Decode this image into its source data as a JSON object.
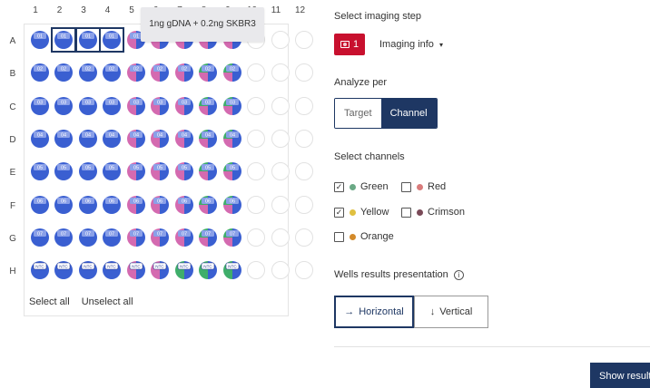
{
  "plate": {
    "columns": [
      "1",
      "2",
      "3",
      "4",
      "5",
      "6",
      "7",
      "8",
      "9",
      "10",
      "11",
      "12"
    ],
    "rows": [
      "A",
      "B",
      "C",
      "D",
      "E",
      "F",
      "G",
      "H"
    ],
    "filled_columns": 9,
    "selected_wells": [
      "A2",
      "A3",
      "A4"
    ],
    "well_labels": [
      "01",
      "02",
      "03",
      "04",
      "05",
      "06",
      "07",
      "NTC"
    ],
    "colors": {
      "blue": "#3a5fd1",
      "blue_dark": "#2a3c8f",
      "pink": "#d46ab0",
      "green": "#3fae6a",
      "cap": "#8aa0e8"
    },
    "footer": {
      "select_all": "Select all",
      "unselect_all": "Unselect all"
    }
  },
  "tooltip": {
    "text": "1ng gDNA + 0.2ng SKBR3"
  },
  "imaging_step": {
    "title": "Select imaging step",
    "step_number": "1",
    "step_icon": "image-icon",
    "info_label": "Imaging info",
    "info_caret": "▾",
    "accent": "#c8102e"
  },
  "analyze": {
    "title": "Analyze per",
    "options": [
      "Target",
      "Channel"
    ],
    "selected": "Channel"
  },
  "channels": {
    "title": "Select channels",
    "items": [
      {
        "label": "Green",
        "color": "#6aa985",
        "checked": true
      },
      {
        "label": "Red",
        "color": "#d97b7b",
        "checked": false
      },
      {
        "label": "Yellow",
        "color": "#e0c040",
        "checked": true
      },
      {
        "label": "Crimson",
        "color": "#7a4a58",
        "checked": false
      },
      {
        "label": "Orange",
        "color": "#d38a2a",
        "checked": false
      }
    ],
    "check_mark": "✓"
  },
  "presentation": {
    "title": "Wells results presentation",
    "info_icon_glyph": "i",
    "options": [
      {
        "label": "Horizontal",
        "arrow": "→"
      },
      {
        "label": "Vertical",
        "arrow": "↓"
      }
    ],
    "selected": "Horizontal"
  },
  "actions": {
    "show_results": "Show results"
  }
}
